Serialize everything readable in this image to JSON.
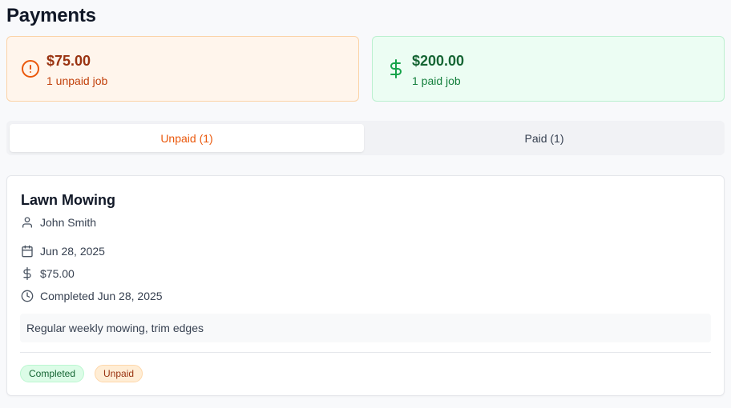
{
  "page": {
    "title": "Payments"
  },
  "summary": {
    "unpaid": {
      "amount": "$75.00",
      "subtitle": "1 unpaid job",
      "icon": "alert-circle-icon",
      "color": "#ea580c"
    },
    "paid": {
      "amount": "$200.00",
      "subtitle": "1 paid job",
      "icon": "dollar-sign-icon",
      "color": "#16a34a"
    }
  },
  "tabs": [
    {
      "label": "Unpaid (1)",
      "active": true
    },
    {
      "label": "Paid (1)",
      "active": false
    }
  ],
  "job": {
    "title": "Lawn Mowing",
    "client": "John Smith",
    "date": "Jun 28, 2025",
    "amount": "$75.00",
    "completed": "Completed Jun 28, 2025",
    "notes": "Regular weekly mowing, trim edges",
    "badges": [
      {
        "label": "Completed",
        "color": "#166534"
      },
      {
        "label": "Unpaid",
        "color": "#9a3412"
      }
    ]
  }
}
